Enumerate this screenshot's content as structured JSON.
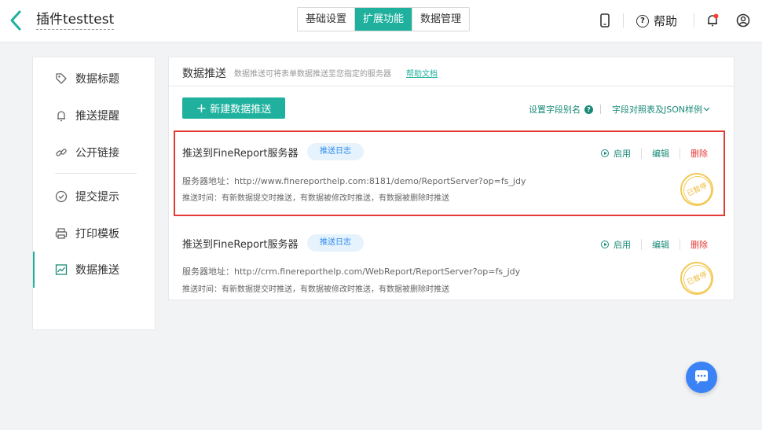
{
  "header": {
    "title": "插件testtest",
    "tabs": [
      {
        "label": "基础设置",
        "active": false
      },
      {
        "label": "扩展功能",
        "active": true
      },
      {
        "label": "数据管理",
        "active": false
      }
    ],
    "help_label": "帮助",
    "icons": [
      "back-chevron-icon",
      "mobile-icon",
      "help-icon",
      "bell-icon",
      "user-icon"
    ],
    "accent_color": "#1fb19e"
  },
  "sidebar": {
    "items": [
      {
        "label": "数据标题",
        "icon": "tag-icon",
        "active": false
      },
      {
        "label": "推送提醒",
        "icon": "bell-icon",
        "active": false
      },
      {
        "label": "公开链接",
        "icon": "link-icon",
        "active": false
      },
      {
        "label": "提交提示",
        "icon": "check-circle-icon",
        "active": false
      },
      {
        "label": "打印模板",
        "icon": "printer-icon",
        "active": false
      },
      {
        "label": "数据推送",
        "icon": "line-chart-icon",
        "active": true
      }
    ]
  },
  "main": {
    "title": "数据推送",
    "description": "数据推送可将表单数据推送至您指定的服务器",
    "help_doc_label": "帮助文档",
    "new_button_label": "新建数据推送",
    "alias_label": "设置字段别名",
    "sample_label": "字段对照表及JSON样例",
    "cards": [
      {
        "title": "推送到FineReport服务器",
        "log_label": "推送日志",
        "url": "服务器地址：http://www.finereporthelp.com:8181/demo/ReportServer?op=fs_jdy",
        "time": "推送时间：有新数据提交时推送，有数据被修改时推送，有数据被删除时推送",
        "enable_label": "启用",
        "edit_label": "编辑",
        "delete_label": "删除",
        "stamp_label": "已暂停",
        "highlighted": true
      },
      {
        "title": "推送到FineReport服务器",
        "log_label": "推送日志",
        "url": "服务器地址：http://crm.finereporthelp.com/WebReport/ReportServer?op=fs_jdy",
        "time": "推送时间：有新数据提交时推送，有数据被修改时推送，有数据被删除时推送",
        "enable_label": "启用",
        "edit_label": "编辑",
        "delete_label": "删除",
        "stamp_label": "已暂停",
        "highlighted": false
      }
    ]
  },
  "chat_icon": "chat-bubble-icon"
}
